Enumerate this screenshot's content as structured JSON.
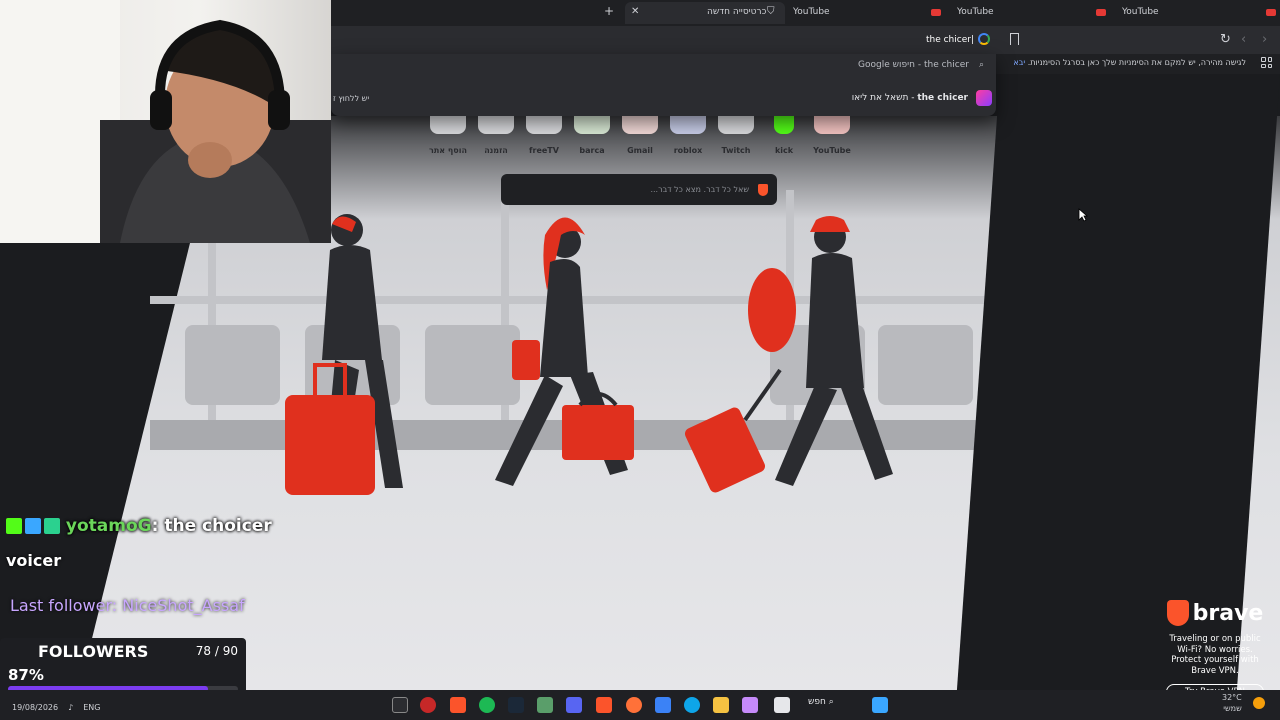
{
  "tabs": [
    {
      "label": "YouTube"
    },
    {
      "label": "YouTube"
    },
    {
      "label": "YouTube"
    },
    {
      "label": "כרטיסייה חדשה"
    }
  ],
  "omnibox": {
    "value": "the chicer"
  },
  "bookmarks_bar": {
    "text": "לגישה מהירה, יש למקם את הסימניות שלך כאן בסרגל הסימניות.",
    "import_link": "יבא"
  },
  "suggestions": {
    "google": {
      "query": "the chicer",
      "suffix": "- חיפוש Google"
    },
    "leo": {
      "query": "the chicer",
      "suffix": "- תשאל את ליאו"
    },
    "side_hint": "יש ללחוץ ז"
  },
  "tiles": [
    {
      "label": "YouTube"
    },
    {
      "label": "kick"
    },
    {
      "label": "Twitch"
    },
    {
      "label": "roblox"
    },
    {
      "label": "Gmail"
    },
    {
      "label": "barca"
    },
    {
      "label": "freeTV"
    },
    {
      "label": "הזמנה"
    },
    {
      "label": "הוסף אתר"
    }
  ],
  "ntp_search": {
    "placeholder": "שאל כל דבר. מצא כל דבר..."
  },
  "chat": {
    "user": "yotamoG",
    "message": ": the choicer",
    "line2": "voicer"
  },
  "last_follower": "Last follower: NiceShot_Assaf",
  "followers_goal": {
    "title": "FOLLOWERS",
    "count": "78 / 90",
    "percent_label": "87%",
    "progress": 0.87
  },
  "brave_ad": {
    "brand": "brave",
    "text": [
      "Traveling or on public",
      "Wi-Fi? No worries.",
      "Protect yourself with",
      "Brave VPN."
    ],
    "button": "Try Brave VPN"
  },
  "taskbar": {
    "search": "חפש",
    "lang": "ENG",
    "date": "19/08/2026",
    "tray": [
      "32°C",
      "שמשי"
    ]
  },
  "colors": {
    "accent_red": "#e0301e",
    "brave_orange": "#fb542b",
    "chat_user": "#6bd65a",
    "follower_purple": "#c8a6ff",
    "progress_fill": "#7b3cf0"
  }
}
